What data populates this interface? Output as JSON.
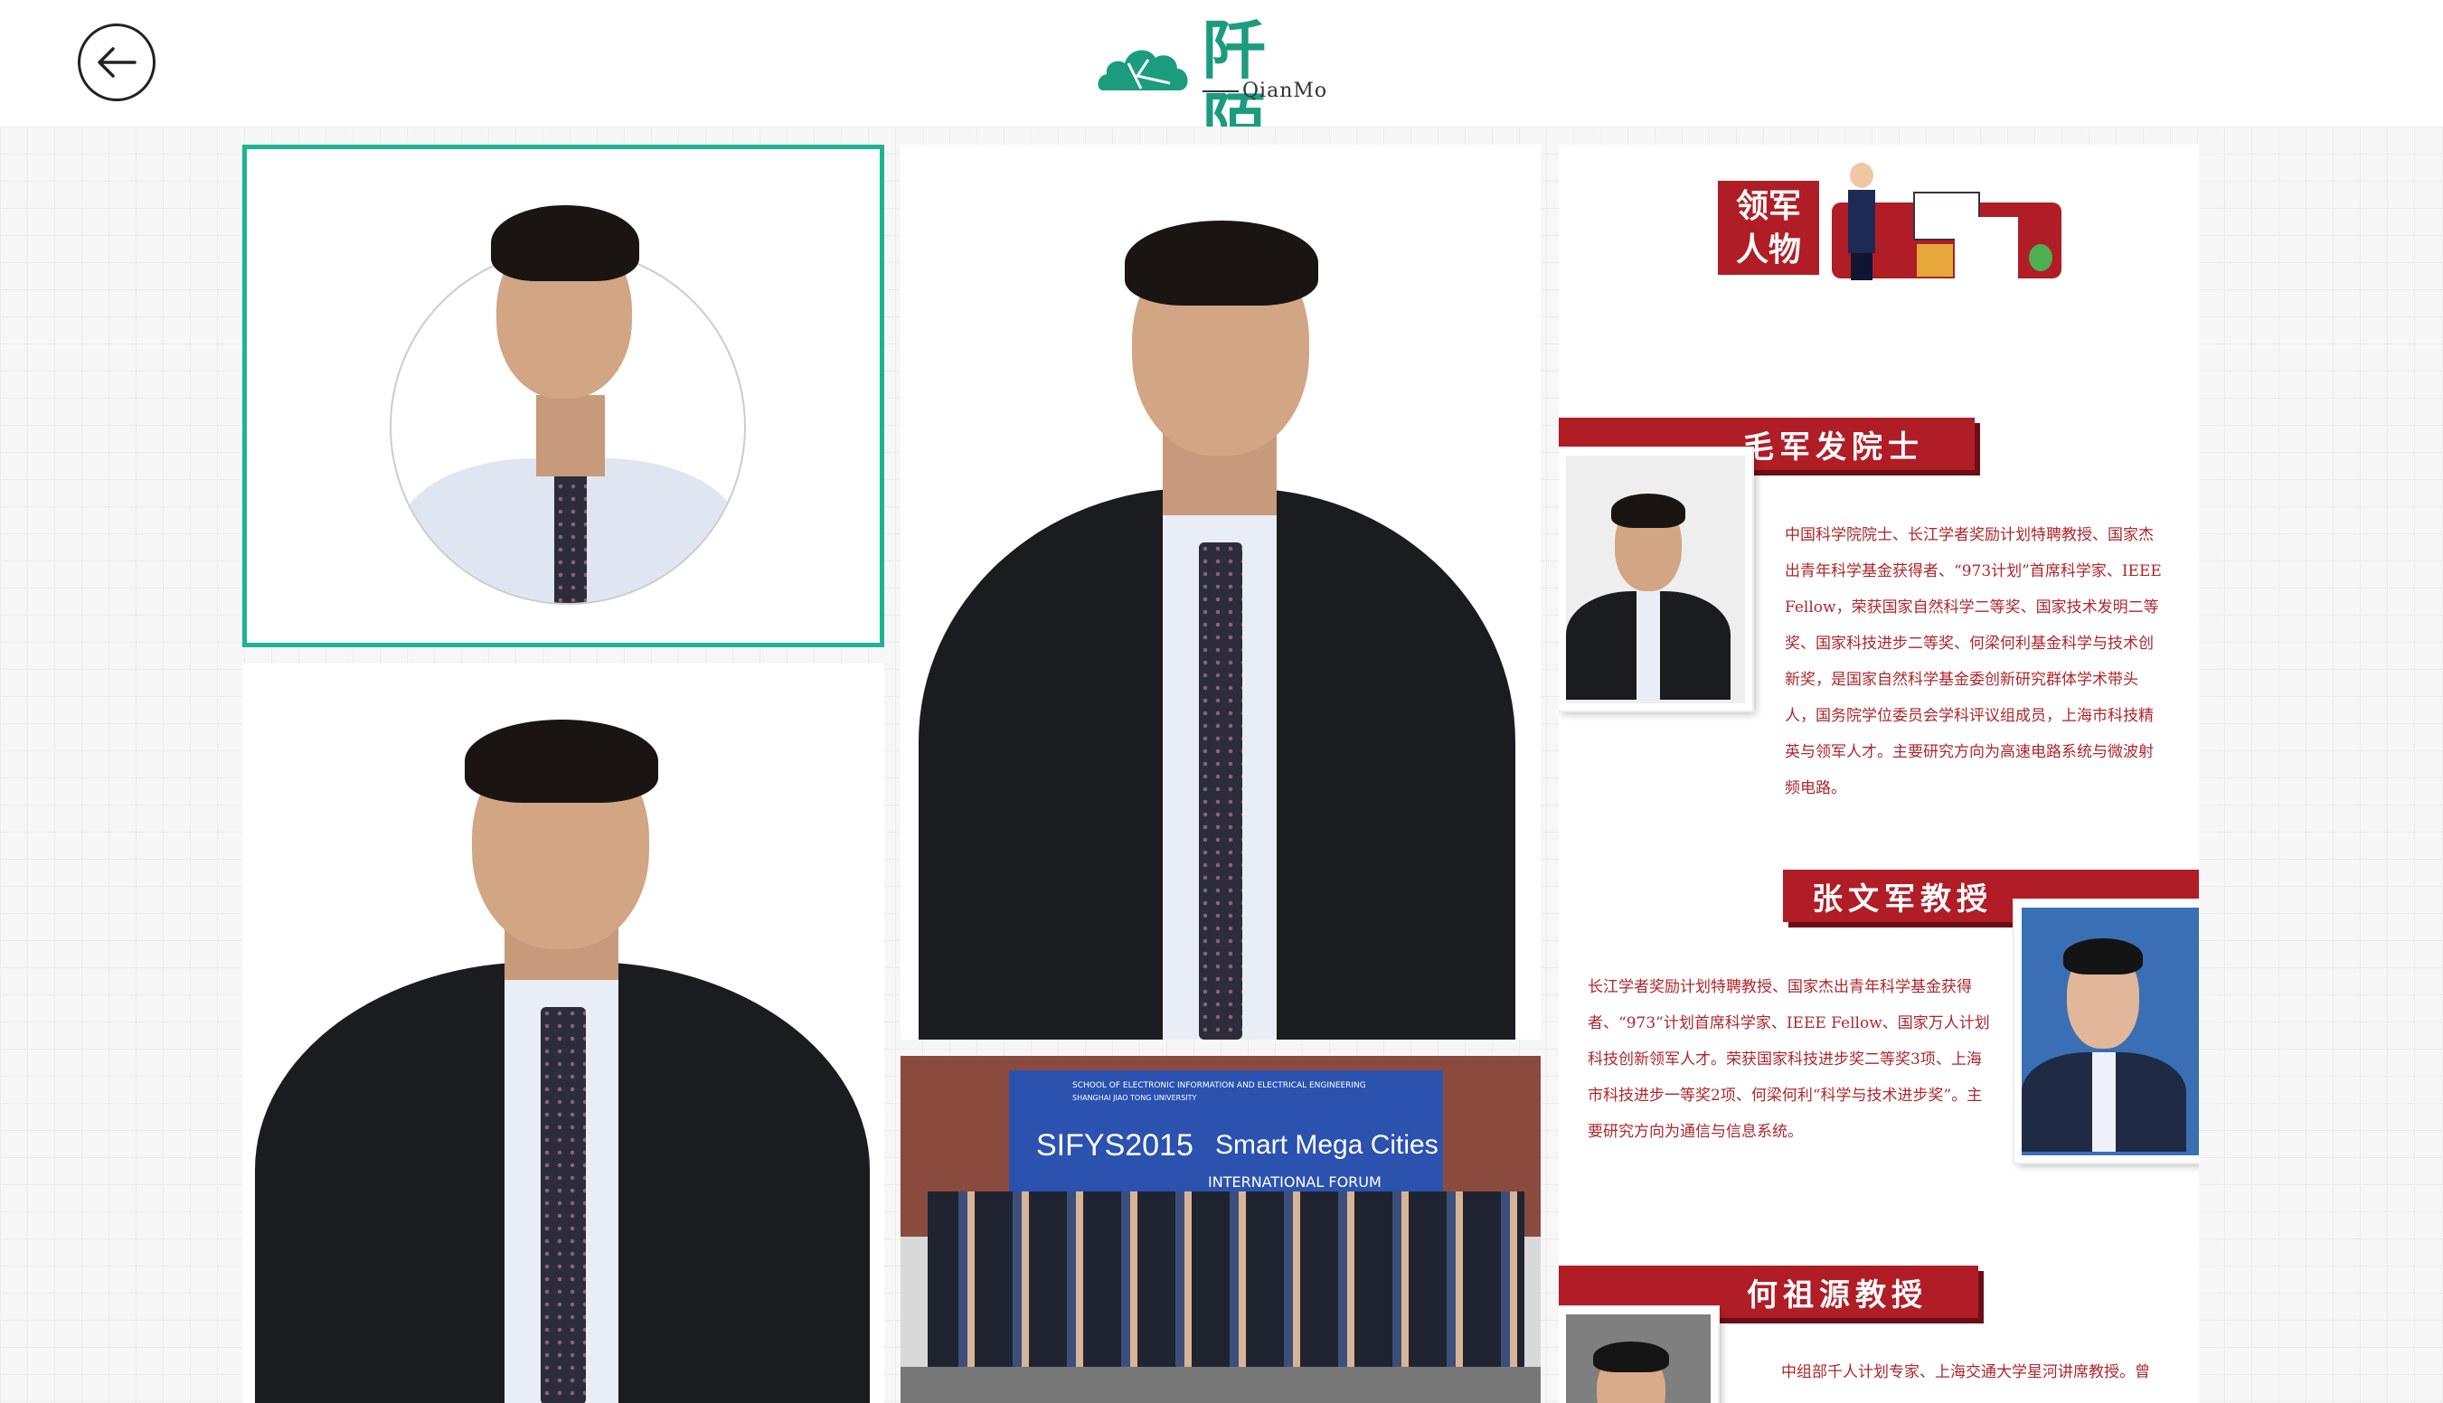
{
  "header": {
    "logo_cn": "阡陌",
    "logo_en": "QianMo"
  },
  "panel": {
    "banner_line1": "领军",
    "banner_line2": "人物"
  },
  "people": [
    {
      "name": "毛军发院士",
      "bio": "中国科学院院士、长江学者奖励计划特聘教授、国家杰出青年科学基金获得者、“973计划”首席科学家、IEEE Fellow，荣获国家自然科学二等奖、国家技术发明二等奖、国家科技进步二等奖、何梁何利基金科学与技术创新奖，是国家自然科学基金委创新研究群体学术带头人，国务院学位委员会学科评议组成员，上海市科技精英与领军人才。主要研究方向为高速电路系统与微波射频电路。"
    },
    {
      "name": "张文军教授",
      "bio": "长江学者奖励计划特聘教授、国家杰出青年科学基金获得者、“973”计划首席科学家、IEEE Fellow、国家万人计划科技创新领军人才。荣获国家科技进步奖二等奖3项、上海市科技进步一等奖2项、何梁何利“科学与技术进步奖”。主要研究方向为通信与信息系统。"
    },
    {
      "name": "何祖源教授",
      "bio": "中组部千人计划专家、上海交通大学星河讲席教授。曾"
    }
  ],
  "group_photo": {
    "school_line1": "SCHOOL OF ELECTRONIC INFORMATION AND ELECTRICAL ENGINEERING",
    "school_line2": "SHANGHAI JIAO TONG UNIVERSITY",
    "event": "SIFYS2015",
    "theme": "Smart Mega Cities",
    "subtitle": "INTERNATIONAL FORUM"
  },
  "colors": {
    "accent": "#1fb394",
    "red": "#b11d26",
    "logo_green": "#1c9c7e"
  }
}
